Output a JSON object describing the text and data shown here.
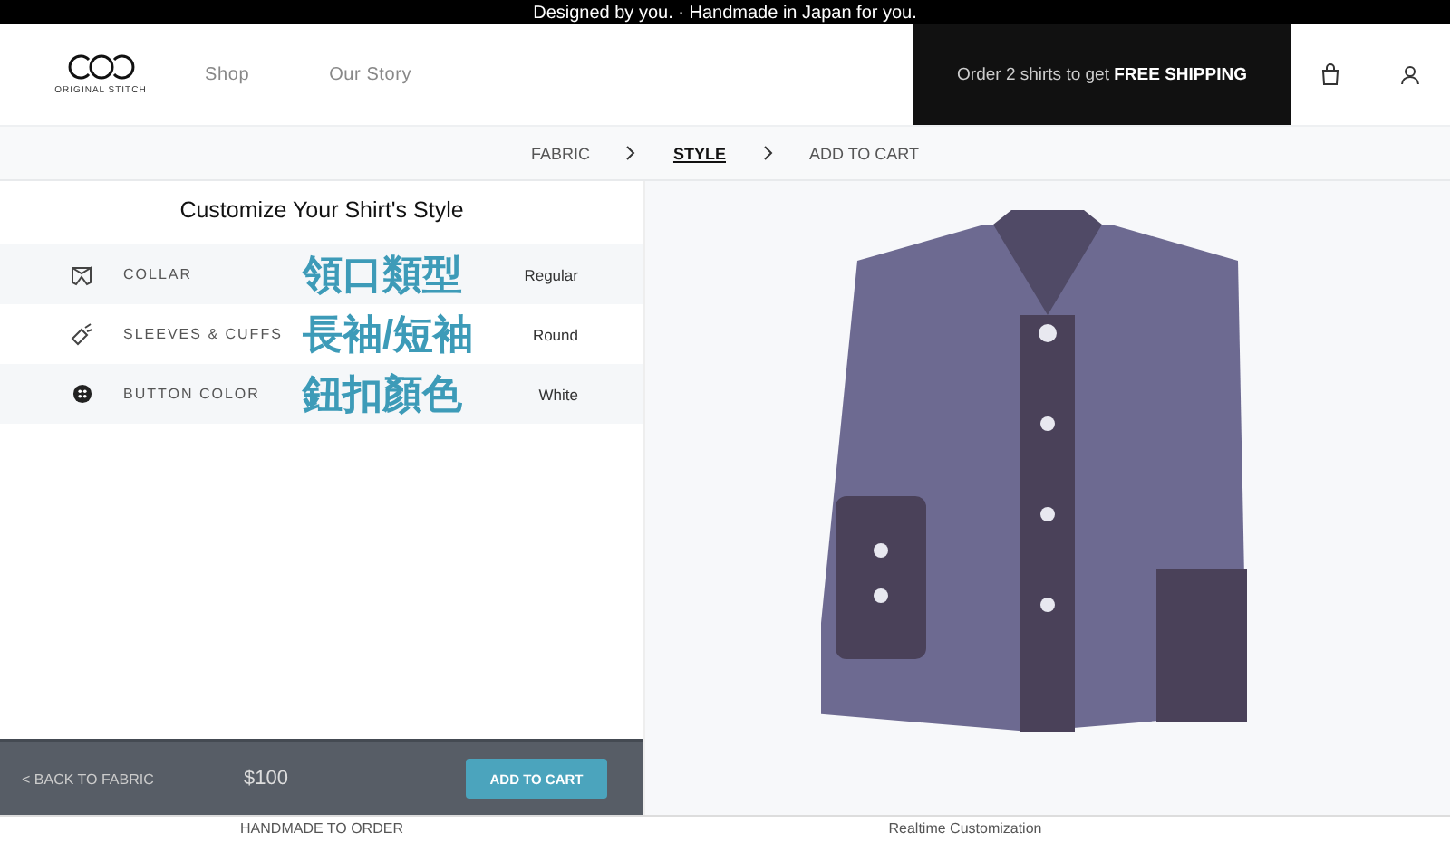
{
  "top_banner": "Designed by you. · Handmade in Japan for you.",
  "header": {
    "logo_text": "ORIGINAL STITCH",
    "nav": [
      {
        "label": "Shop"
      },
      {
        "label": "Our Story"
      }
    ],
    "promo": {
      "text": "Order 2 shirts to get **FREE SHIPPING**"
    }
  },
  "steps": [
    {
      "label": "FABRIC",
      "selected": false
    },
    {
      "label": "STYLE",
      "selected": true
    },
    {
      "label": "ADD TO CART",
      "selected": false
    }
  ],
  "panel": {
    "title": "Customize Your Shirt's Style",
    "options": [
      {
        "kind": "collar",
        "label": "COLLAR",
        "annotation": "領口類型",
        "value": "Regular"
      },
      {
        "kind": "sleeve",
        "label": "SLEEVES & CUFFS",
        "annotation": "長袖/短袖",
        "value": "Round"
      },
      {
        "kind": "button",
        "label": "BUTTON COLOR",
        "annotation": "鈕扣顏色",
        "value": "White"
      }
    ]
  },
  "footer_bar": {
    "back": "< BACK TO FABRIC",
    "price": "$100",
    "add_button": "ADD TO CART"
  },
  "bottom_strip": [
    "HANDMADE TO ORDER",
    "Realtime Customization"
  ]
}
